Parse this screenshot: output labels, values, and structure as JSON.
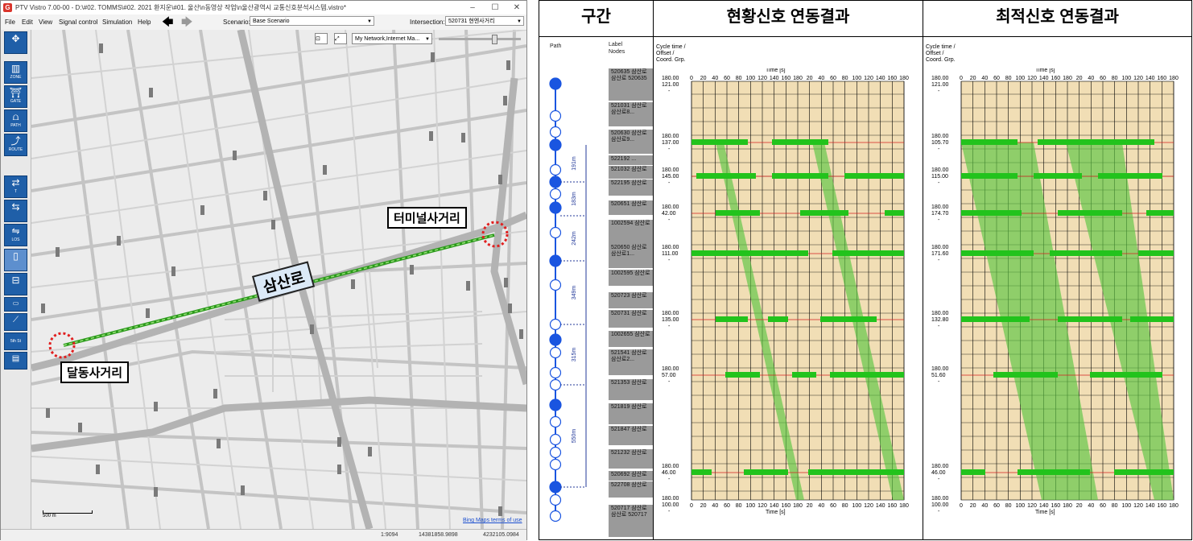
{
  "app": {
    "title": "PTV Vistro 7.00-00 - D:\\#02. TOMMS\\#02. 2021 환지운\\#01. 울산\\n동영상 작업\\n울산광역시 교통신호분석시스템.vistro*",
    "menu": [
      "File",
      "Edit",
      "View",
      "Signal control",
      "Simulation",
      "Help"
    ],
    "scenario_label": "Scenario:",
    "scenario_value": "Base Scenario",
    "intersection_label": "Intersection:",
    "intersection_value": "520731 현엔사거리",
    "map_layer": "My Network,Internet Ma...",
    "tools": [
      "ZONE",
      "GATE",
      "PATH",
      "ROUTE",
      "T",
      "LOS",
      "5th St"
    ],
    "status": {
      "scale": "1:9094",
      "x": "14381858.9898",
      "y": "4232105.0984"
    },
    "scalebar_label": "500 m",
    "bing_link": "Bing Maps terms of use"
  },
  "map_labels": {
    "terminal": "터미널사거리",
    "samsan": "삼산로",
    "daldong": "달동사거리"
  },
  "panel": {
    "col1_header": "구간",
    "col2_header": "현황신호 연동결과",
    "col3_header": "최적신호 연동결과",
    "path_label": "Path",
    "label_nodes": [
      "Label",
      "Nodes"
    ],
    "diagram_header": [
      "Cycle time /",
      "Offset /",
      "Coord. Grp."
    ],
    "time_label": "Time [s]",
    "ticks": [
      "0",
      "20",
      "40",
      "60",
      "80",
      "100",
      "120",
      "140",
      "160",
      "180",
      "20",
      "40",
      "60",
      "80",
      "100",
      "120",
      "140",
      "160",
      "180"
    ],
    "segments": [
      "191m",
      "183m",
      "242m",
      "349m",
      "315m",
      "550m"
    ],
    "nodes": [
      "520635 삼산로 삼산로 520635",
      "521031 삼산로 삼산로8...",
      "520630 삼산로 삼산로9...",
      "522192 ...",
      "521032 삼산로",
      "522195 삼산로",
      "520651 삼산로",
      "1002594 삼산로",
      "520650 삼산로 삼산로1...",
      "1002595 삼산로",
      "520723 삼산로",
      "520731 삼산로",
      "1002655 삼산로",
      "521541 삼산로 삼산로2...",
      "521353 삼산로",
      "521819 삼산로",
      "521847 삼산로",
      "521232 삼산로",
      "520692 삼산로",
      "522708 삼산로",
      "520717 삼산로 삼산로 520717"
    ],
    "current_cycles": [
      {
        "cycle": "180.00",
        "offset": "121.00",
        "grp": "-"
      },
      {
        "cycle": "180.00",
        "offset": "137.00",
        "grp": "-"
      },
      {
        "cycle": "180.00",
        "offset": "145.00",
        "grp": "-"
      },
      {
        "cycle": "180.00",
        "offset": "42.00",
        "grp": "-"
      },
      {
        "cycle": "180.00",
        "offset": "111.00",
        "grp": "-"
      },
      {
        "cycle": "180.00",
        "offset": "135.00",
        "grp": "-"
      },
      {
        "cycle": "180.00",
        "offset": "57.00",
        "grp": "-"
      },
      {
        "cycle": "180.00",
        "offset": "46.00",
        "grp": "-"
      },
      {
        "cycle": "180.00",
        "offset": "100.00",
        "grp": "-"
      }
    ],
    "optimal_cycles": [
      {
        "cycle": "180.00",
        "offset": "121.00",
        "grp": "-"
      },
      {
        "cycle": "180.00",
        "offset": "105.70",
        "grp": "-"
      },
      {
        "cycle": "180.00",
        "offset": "115.00",
        "grp": "-"
      },
      {
        "cycle": "180.00",
        "offset": "174.70",
        "grp": "-"
      },
      {
        "cycle": "180.00",
        "offset": "171.60",
        "grp": "-"
      },
      {
        "cycle": "180.00",
        "offset": "132.80",
        "grp": "-"
      },
      {
        "cycle": "180.00",
        "offset": "51.60",
        "grp": "-"
      },
      {
        "cycle": "180.00",
        "offset": "46.00",
        "grp": "-"
      },
      {
        "cycle": "180.00",
        "offset": "100.00",
        "grp": "-"
      }
    ]
  },
  "colors": {
    "band": "#5ac442",
    "green_bar": "#22c31c",
    "diagram_bg": "#f1deb5",
    "path_node": "#1a55e0",
    "red_line": "#d42020"
  }
}
